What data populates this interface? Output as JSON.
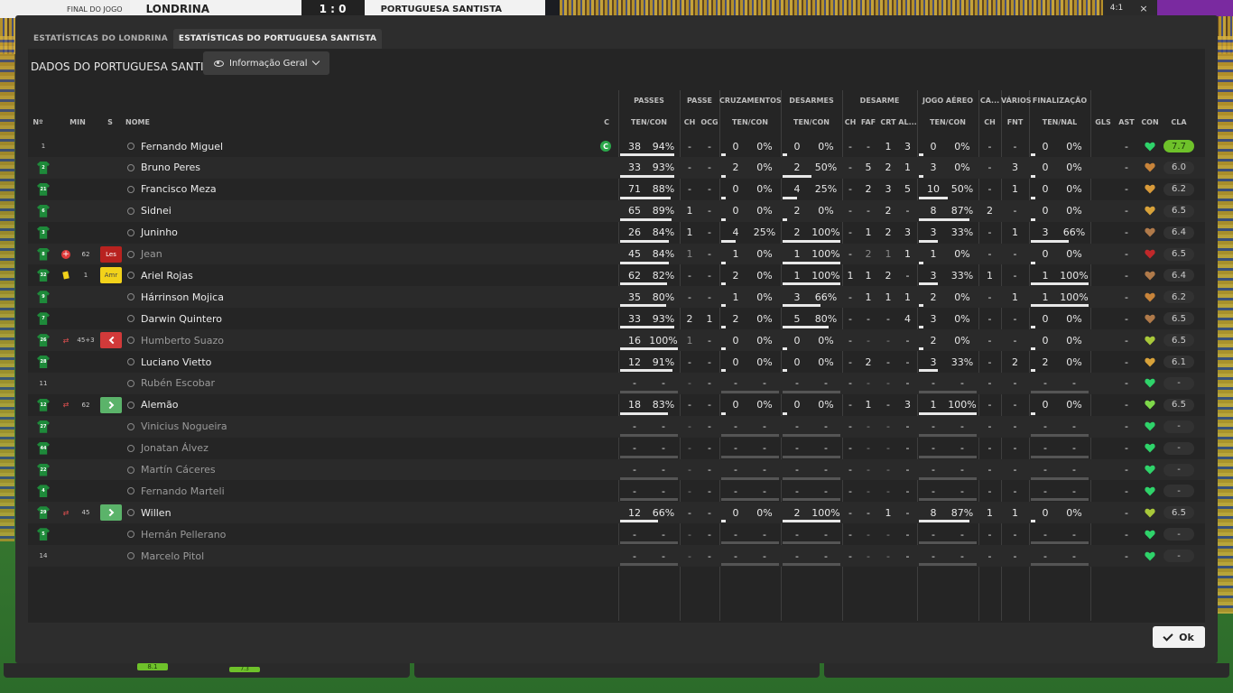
{
  "scoreboard": {
    "status": "FINAL DO JOGO",
    "home": "LONDRINA",
    "score": "1 : 0",
    "away": "PORTUGUESA SANTISTA",
    "top_right_a": "4:1",
    "top_right_b": "×"
  },
  "tabs": [
    {
      "label": "ESTATÍSTICAS DO LONDRINA",
      "active": false
    },
    {
      "label": "ESTATÍSTICAS DO PORTUGUESA SANTISTA",
      "active": true
    }
  ],
  "panel": {
    "title": "DADOS DO PORTUGUESA SANTISTA",
    "dropdown_label": "Informação Geral"
  },
  "groups": [
    "PASSES",
    "PASSE",
    "CRUZAMENTOS",
    "DESARMES",
    "DESARME",
    "JOGO AÉREO",
    "CA...",
    "VÁRIOS",
    "FINALIZAÇÃO"
  ],
  "columns": {
    "num": "Nº",
    "min": "MIN",
    "s": "S",
    "name": "NOME",
    "c": "C",
    "passes": "TEN/CON",
    "passe_ch": "CH",
    "passe_ocg": "OCG",
    "cruz": "TEN/CON",
    "desarmes": "TEN/CON",
    "des_ch": "CH",
    "des_faf": "FAF",
    "des_crt": "CRT",
    "des_al": "AL...",
    "aereo": "TEN/CON",
    "ca_ch": "CH",
    "varios_fnt": "FNT",
    "final": "TEN/NAL",
    "gls": "GLS",
    "ast": "AST",
    "con": "CON",
    "cla": "CLA"
  },
  "players": [
    {
      "num": "1",
      "shirt": false,
      "ev": "",
      "min": "",
      "s": "",
      "name": "Fernando Miguel",
      "dim": false,
      "captain": "C",
      "pas": [
        "38",
        "94%"
      ],
      "pch": "-",
      "pocg": "-",
      "cru": [
        "0",
        "0%"
      ],
      "des": [
        "0",
        "0%"
      ],
      "dch": "-",
      "dfaf": "-",
      "dcrt": "1",
      "dal": "3",
      "aer": [
        "0",
        "0%"
      ],
      "cach": "-",
      "fnt": "-",
      "fin": [
        "0",
        "0%"
      ],
      "gls": "",
      "ast": "-",
      "con": "#2fd36a",
      "cla": "7.7",
      "top": true,
      "bars": [
        0.94,
        0,
        0,
        0,
        0
      ]
    },
    {
      "num": "2",
      "shirt": true,
      "ev": "",
      "min": "",
      "s": "",
      "name": "Bruno Peres",
      "dim": false,
      "captain": "",
      "pas": [
        "33",
        "93%"
      ],
      "pch": "-",
      "pocg": "-",
      "cru": [
        "2",
        "0%"
      ],
      "des": [
        "2",
        "50%"
      ],
      "dch": "-",
      "dfaf": "5",
      "dcrt": "2",
      "dal": "1",
      "aer": [
        "3",
        "0%"
      ],
      "cach": "-",
      "fnt": "3",
      "fin": [
        "0",
        "0%"
      ],
      "gls": "",
      "ast": "-",
      "con": "#c8843a",
      "cla": "6.0",
      "top": false,
      "bars": [
        0.93,
        0,
        0.5,
        0,
        0
      ]
    },
    {
      "num": "21",
      "shirt": true,
      "ev": "",
      "min": "",
      "s": "",
      "name": "Francisco Meza",
      "dim": false,
      "captain": "",
      "pas": [
        "71",
        "88%"
      ],
      "pch": "-",
      "pocg": "-",
      "cru": [
        "0",
        "0%"
      ],
      "des": [
        "4",
        "25%"
      ],
      "dch": "-",
      "dfaf": "2",
      "dcrt": "3",
      "dal": "5",
      "aer": [
        "10",
        "50%"
      ],
      "cach": "-",
      "fnt": "1",
      "fin": [
        "0",
        "0%"
      ],
      "gls": "",
      "ast": "-",
      "con": "#d89a3a",
      "cla": "6.2",
      "top": false,
      "bars": [
        0.88,
        0,
        0.25,
        0.5,
        0
      ]
    },
    {
      "num": "6",
      "shirt": true,
      "ev": "",
      "min": "",
      "s": "",
      "name": "Sidnei",
      "dim": false,
      "captain": "",
      "pas": [
        "65",
        "89%"
      ],
      "pch": "1",
      "pocg": "-",
      "cru": [
        "0",
        "0%"
      ],
      "des": [
        "2",
        "0%"
      ],
      "dch": "-",
      "dfaf": "-",
      "dcrt": "2",
      "dal": "-",
      "aer": [
        "8",
        "87%"
      ],
      "cach": "2",
      "fnt": "-",
      "fin": [
        "0",
        "0%"
      ],
      "gls": "",
      "ast": "-",
      "con": "#d8a23a",
      "cla": "6.5",
      "top": false,
      "bars": [
        0.89,
        0,
        0,
        0.87,
        0
      ]
    },
    {
      "num": "3",
      "shirt": true,
      "ev": "",
      "min": "",
      "s": "",
      "name": "Juninho",
      "dim": false,
      "captain": "",
      "pas": [
        "26",
        "84%"
      ],
      "pch": "1",
      "pocg": "-",
      "cru": [
        "4",
        "25%"
      ],
      "des": [
        "2",
        "100%"
      ],
      "dch": "-",
      "dfaf": "1",
      "dcrt": "2",
      "dal": "3",
      "aer": [
        "3",
        "33%"
      ],
      "cach": "-",
      "fnt": "1",
      "fin": [
        "3",
        "66%"
      ],
      "gls": "",
      "ast": "-",
      "con": "#b07a4a",
      "cla": "6.4",
      "top": false,
      "bars": [
        0.84,
        0.25,
        1,
        0.33,
        0.66
      ]
    },
    {
      "num": "8",
      "shirt": true,
      "ev": "injury",
      "min": "62",
      "s": "Les",
      "name": "Jean",
      "dim": true,
      "captain": "",
      "pas": [
        "45",
        "84%"
      ],
      "pch": "1",
      "pocg": "-",
      "cru": [
        "1",
        "0%"
      ],
      "des": [
        "1",
        "100%"
      ],
      "dch": "-",
      "dfaf": "2",
      "dcrt": "1",
      "dal": "1",
      "aer": [
        "1",
        "0%"
      ],
      "cach": "-",
      "fnt": "-",
      "fin": [
        "0",
        "0%"
      ],
      "gls": "",
      "ast": "-",
      "con": "#c0282a",
      "cla": "6.5",
      "top": false,
      "bars": [
        0.84,
        0,
        1,
        0,
        0
      ]
    },
    {
      "num": "32",
      "shirt": true,
      "ev": "yellow",
      "min": "1",
      "s": "Amr",
      "name": "Ariel Rojas",
      "dim": false,
      "captain": "",
      "pas": [
        "62",
        "82%"
      ],
      "pch": "-",
      "pocg": "-",
      "cru": [
        "2",
        "0%"
      ],
      "des": [
        "1",
        "100%"
      ],
      "dch": "1",
      "dfaf": "1",
      "dcrt": "2",
      "dal": "-",
      "aer": [
        "3",
        "33%"
      ],
      "cach": "1",
      "fnt": "-",
      "fin": [
        "1",
        "100%"
      ],
      "gls": "",
      "ast": "-",
      "con": "#b07a4a",
      "cla": "6.4",
      "top": false,
      "bars": [
        0.82,
        0,
        1,
        0.33,
        1
      ]
    },
    {
      "num": "9",
      "shirt": true,
      "ev": "",
      "min": "",
      "s": "",
      "name": "Hárrinson Mojica",
      "dim": false,
      "captain": "",
      "pas": [
        "35",
        "80%"
      ],
      "pch": "-",
      "pocg": "-",
      "cru": [
        "1",
        "0%"
      ],
      "des": [
        "3",
        "66%"
      ],
      "dch": "-",
      "dfaf": "1",
      "dcrt": "1",
      "dal": "1",
      "aer": [
        "2",
        "0%"
      ],
      "cach": "-",
      "fnt": "1",
      "fin": [
        "1",
        "100%"
      ],
      "gls": "",
      "ast": "-",
      "con": "#c8843a",
      "cla": "6.2",
      "top": false,
      "bars": [
        0.8,
        0,
        0.66,
        0,
        1
      ]
    },
    {
      "num": "7",
      "shirt": true,
      "ev": "",
      "min": "",
      "s": "",
      "name": "Darwin Quintero",
      "dim": false,
      "captain": "",
      "pas": [
        "33",
        "93%"
      ],
      "pch": "2",
      "pocg": "1",
      "cru": [
        "2",
        "0%"
      ],
      "des": [
        "5",
        "80%"
      ],
      "dch": "-",
      "dfaf": "-",
      "dcrt": "-",
      "dal": "4",
      "aer": [
        "3",
        "0%"
      ],
      "cach": "-",
      "fnt": "-",
      "fin": [
        "0",
        "0%"
      ],
      "gls": "",
      "ast": "-",
      "con": "#b07a4a",
      "cla": "6.5",
      "top": false,
      "bars": [
        0.93,
        0,
        0.8,
        0,
        0
      ]
    },
    {
      "num": "26",
      "shirt": true,
      "ev": "sub",
      "min": "45+3",
      "s": "out",
      "name": "Humberto Suazo",
      "dim": true,
      "captain": "",
      "pas": [
        "16",
        "100%"
      ],
      "pch": "1",
      "pocg": "-",
      "cru": [
        "0",
        "0%"
      ],
      "des": [
        "0",
        "0%"
      ],
      "dch": "-",
      "dfaf": "-",
      "dcrt": "-",
      "dal": "-",
      "aer": [
        "2",
        "0%"
      ],
      "cach": "-",
      "fnt": "-",
      "fin": [
        "0",
        "0%"
      ],
      "gls": "",
      "ast": "-",
      "con": "#a8c83a",
      "cla": "6.5",
      "top": false,
      "bars": [
        1,
        0,
        0,
        0,
        0
      ]
    },
    {
      "num": "28",
      "shirt": true,
      "ev": "",
      "min": "",
      "s": "",
      "name": "Luciano Vietto",
      "dim": false,
      "captain": "",
      "pas": [
        "12",
        "91%"
      ],
      "pch": "-",
      "pocg": "-",
      "cru": [
        "0",
        "0%"
      ],
      "des": [
        "0",
        "0%"
      ],
      "dch": "-",
      "dfaf": "2",
      "dcrt": "-",
      "dal": "-",
      "aer": [
        "3",
        "33%"
      ],
      "cach": "-",
      "fnt": "2",
      "fin": [
        "2",
        "0%"
      ],
      "gls": "",
      "ast": "-",
      "con": "#d8a23a",
      "cla": "6.1",
      "top": false,
      "bars": [
        0.91,
        0,
        0,
        0.33,
        0
      ]
    },
    {
      "num": "11",
      "shirt": false,
      "ev": "",
      "min": "",
      "s": "",
      "name": "Rubén Escobar",
      "dim": true,
      "captain": "",
      "pas": [
        "-",
        "-"
      ],
      "pch": "-",
      "pocg": "-",
      "cru": [
        "-",
        "-"
      ],
      "des": [
        "-",
        "-"
      ],
      "dch": "-",
      "dfaf": "-",
      "dcrt": "-",
      "dal": "-",
      "aer": [
        "-",
        "-"
      ],
      "cach": "-",
      "fnt": "-",
      "fin": [
        "-",
        "-"
      ],
      "gls": "",
      "ast": "-",
      "con": "#2fd36a",
      "cla": "-",
      "top": false,
      "bars": [
        -1,
        -1,
        -1,
        -1,
        -1
      ]
    },
    {
      "num": "12",
      "shirt": true,
      "ev": "sub",
      "min": "62",
      "s": "in",
      "name": "Alemão",
      "dim": false,
      "captain": "",
      "pas": [
        "18",
        "83%"
      ],
      "pch": "-",
      "pocg": "-",
      "cru": [
        "0",
        "0%"
      ],
      "des": [
        "0",
        "0%"
      ],
      "dch": "-",
      "dfaf": "1",
      "dcrt": "-",
      "dal": "3",
      "aer": [
        "1",
        "100%"
      ],
      "cach": "-",
      "fnt": "-",
      "fin": [
        "0",
        "0%"
      ],
      "gls": "",
      "ast": "-",
      "con": "#7ed84a",
      "cla": "6.5",
      "top": false,
      "bars": [
        0.83,
        0,
        0,
        1,
        0
      ]
    },
    {
      "num": "27",
      "shirt": true,
      "ev": "",
      "min": "",
      "s": "",
      "name": "Vinicius Nogueira",
      "dim": true,
      "captain": "",
      "pas": [
        "-",
        "-"
      ],
      "pch": "-",
      "pocg": "-",
      "cru": [
        "-",
        "-"
      ],
      "des": [
        "-",
        "-"
      ],
      "dch": "-",
      "dfaf": "-",
      "dcrt": "-",
      "dal": "-",
      "aer": [
        "-",
        "-"
      ],
      "cach": "-",
      "fnt": "-",
      "fin": [
        "-",
        "-"
      ],
      "gls": "",
      "ast": "-",
      "con": "#2fd36a",
      "cla": "-",
      "top": false,
      "bars": [
        -1,
        -1,
        -1,
        -1,
        -1
      ]
    },
    {
      "num": "44",
      "shirt": true,
      "ev": "",
      "min": "",
      "s": "",
      "name": "Jonatan Álvez",
      "dim": true,
      "captain": "",
      "pas": [
        "-",
        "-"
      ],
      "pch": "-",
      "pocg": "-",
      "cru": [
        "-",
        "-"
      ],
      "des": [
        "-",
        "-"
      ],
      "dch": "-",
      "dfaf": "-",
      "dcrt": "-",
      "dal": "-",
      "aer": [
        "-",
        "-"
      ],
      "cach": "-",
      "fnt": "-",
      "fin": [
        "-",
        "-"
      ],
      "gls": "",
      "ast": "-",
      "con": "#2fd36a",
      "cla": "-",
      "top": false,
      "bars": [
        -1,
        -1,
        -1,
        -1,
        -1
      ]
    },
    {
      "num": "22",
      "shirt": true,
      "ev": "",
      "min": "",
      "s": "",
      "name": "Martín Cáceres",
      "dim": true,
      "captain": "",
      "pas": [
        "-",
        "-"
      ],
      "pch": "-",
      "pocg": "-",
      "cru": [
        "-",
        "-"
      ],
      "des": [
        "-",
        "-"
      ],
      "dch": "-",
      "dfaf": "-",
      "dcrt": "-",
      "dal": "-",
      "aer": [
        "-",
        "-"
      ],
      "cach": "-",
      "fnt": "-",
      "fin": [
        "-",
        "-"
      ],
      "gls": "",
      "ast": "-",
      "con": "#2fd36a",
      "cla": "-",
      "top": false,
      "bars": [
        -1,
        -1,
        -1,
        -1,
        -1
      ]
    },
    {
      "num": "4",
      "shirt": true,
      "ev": "",
      "min": "",
      "s": "",
      "name": "Fernando Marteli",
      "dim": true,
      "captain": "",
      "pas": [
        "-",
        "-"
      ],
      "pch": "-",
      "pocg": "-",
      "cru": [
        "-",
        "-"
      ],
      "des": [
        "-",
        "-"
      ],
      "dch": "-",
      "dfaf": "-",
      "dcrt": "-",
      "dal": "-",
      "aer": [
        "-",
        "-"
      ],
      "cach": "-",
      "fnt": "-",
      "fin": [
        "-",
        "-"
      ],
      "gls": "",
      "ast": "-",
      "con": "#2fd36a",
      "cla": "-",
      "top": false,
      "bars": [
        -1,
        -1,
        -1,
        -1,
        -1
      ]
    },
    {
      "num": "29",
      "shirt": true,
      "ev": "sub",
      "min": "45",
      "s": "in",
      "name": "Willen",
      "dim": false,
      "captain": "",
      "pas": [
        "12",
        "66%"
      ],
      "pch": "-",
      "pocg": "-",
      "cru": [
        "0",
        "0%"
      ],
      "des": [
        "2",
        "100%"
      ],
      "dch": "-",
      "dfaf": "-",
      "dcrt": "1",
      "dal": "-",
      "aer": [
        "8",
        "87%"
      ],
      "cach": "1",
      "fnt": "1",
      "fin": [
        "0",
        "0%"
      ],
      "gls": "",
      "ast": "-",
      "con": "#a8c83a",
      "cla": "6.5",
      "top": false,
      "bars": [
        0.66,
        0,
        1,
        0.87,
        0
      ]
    },
    {
      "num": "5",
      "shirt": true,
      "ev": "",
      "min": "",
      "s": "",
      "name": "Hernán Pellerano",
      "dim": true,
      "captain": "",
      "pas": [
        "-",
        "-"
      ],
      "pch": "-",
      "pocg": "-",
      "cru": [
        "-",
        "-"
      ],
      "des": [
        "-",
        "-"
      ],
      "dch": "-",
      "dfaf": "-",
      "dcrt": "-",
      "dal": "-",
      "aer": [
        "-",
        "-"
      ],
      "cach": "-",
      "fnt": "-",
      "fin": [
        "-",
        "-"
      ],
      "gls": "",
      "ast": "-",
      "con": "#2fd36a",
      "cla": "-",
      "top": false,
      "bars": [
        -1,
        -1,
        -1,
        -1,
        -1
      ]
    },
    {
      "num": "14",
      "shirt": false,
      "ev": "",
      "min": "",
      "s": "",
      "name": "Marcelo Pitol",
      "dim": true,
      "captain": "",
      "pas": [
        "-",
        "-"
      ],
      "pch": "-",
      "pocg": "-",
      "cru": [
        "-",
        "-"
      ],
      "des": [
        "-",
        "-"
      ],
      "dch": "-",
      "dfaf": "-",
      "dcrt": "-",
      "dal": "-",
      "aer": [
        "-",
        "-"
      ],
      "cach": "-",
      "fnt": "-",
      "fin": [
        "-",
        "-"
      ],
      "gls": "",
      "ast": "-",
      "con": "#2fd36a",
      "cla": "-",
      "top": false,
      "bars": [
        -1,
        -1,
        -1,
        -1,
        -1
      ]
    }
  ],
  "ok_button": "Ok",
  "bottom_ratings": [
    "8.1",
    "7.3"
  ]
}
